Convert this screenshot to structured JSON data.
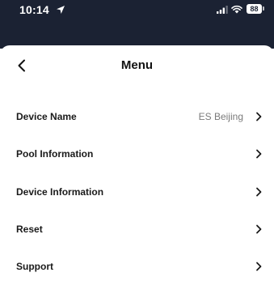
{
  "status_bar": {
    "time": "10:14",
    "battery": "88",
    "icons": [
      "location-arrow-icon",
      "signal-bars-icon",
      "wifi-icon",
      "battery-icon"
    ]
  },
  "header": {
    "title": "Menu",
    "back_icon": "chevron-left-icon"
  },
  "menu": {
    "items": [
      {
        "label": "Device Name",
        "value": "ES Beijing"
      },
      {
        "label": "Pool Information",
        "value": ""
      },
      {
        "label": "Device Information",
        "value": ""
      },
      {
        "label": "Reset",
        "value": ""
      },
      {
        "label": "Support",
        "value": ""
      }
    ],
    "chevron_icon": "chevron-right-icon"
  },
  "colors": {
    "status_bar_bg": "#1b2233",
    "text_primary": "#1a1a1a",
    "text_secondary": "#7a7a7a"
  }
}
